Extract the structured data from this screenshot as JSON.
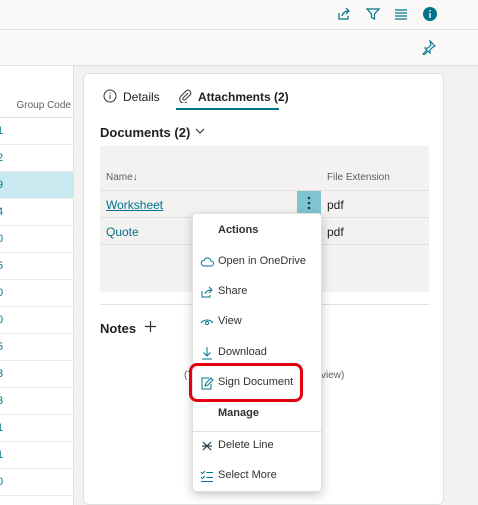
{
  "left_list": {
    "header_partial": "l",
    "group_code_header": "Group Code",
    "rows": [
      "1",
      "2",
      "9",
      "4",
      "0",
      "5",
      "0",
      "0",
      "5",
      "3",
      "3",
      "1",
      "1",
      "0"
    ]
  },
  "panel": {
    "tabs": [
      {
        "label": "Details"
      },
      {
        "label": "Attachments (2)"
      }
    ],
    "documents": {
      "title": "Documents (2)",
      "columns": {
        "name": "Name↓",
        "extension": "File Extension"
      },
      "rows": [
        {
          "name": "Worksheet",
          "extension": "pdf"
        },
        {
          "name": "Quote",
          "extension": "pdf"
        }
      ]
    },
    "notes": {
      "title": "Notes"
    },
    "partial_left": "(T",
    "partial_right": "view)"
  },
  "context_menu": {
    "actions_header": "Actions",
    "actions": [
      {
        "label": "Open in OneDrive",
        "icon": "cloud-icon"
      },
      {
        "label": "Share",
        "icon": "share-icon"
      },
      {
        "label": "View",
        "icon": "eye-icon"
      },
      {
        "label": "Download",
        "icon": "download-icon"
      },
      {
        "label": "Sign Document",
        "icon": "sign-document-icon"
      }
    ],
    "manage_header": "Manage",
    "manage": [
      {
        "label": "Delete Line",
        "icon": "delete-line-icon"
      },
      {
        "label": "Select More",
        "icon": "select-more-icon"
      }
    ]
  },
  "colors": {
    "accent": "#00748b",
    "highlight": "#e3000f",
    "selected_row": "#c7e9ef"
  }
}
